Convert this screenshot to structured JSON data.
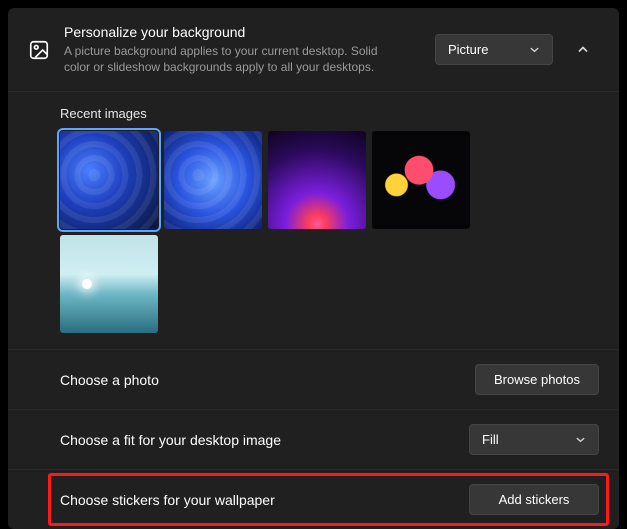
{
  "header": {
    "title": "Personalize your background",
    "subtitle": "A picture background applies to your current desktop. Solid color or slideshow backgrounds apply to all your desktops."
  },
  "bg_type_select": {
    "value": "Picture"
  },
  "recent": {
    "label": "Recent images"
  },
  "choose_photo": {
    "label": "Choose a photo",
    "button": "Browse photos"
  },
  "choose_fit": {
    "label": "Choose a fit for your desktop image",
    "value": "Fill"
  },
  "stickers": {
    "label": "Choose stickers for your wallpaper",
    "button": "Add stickers"
  }
}
